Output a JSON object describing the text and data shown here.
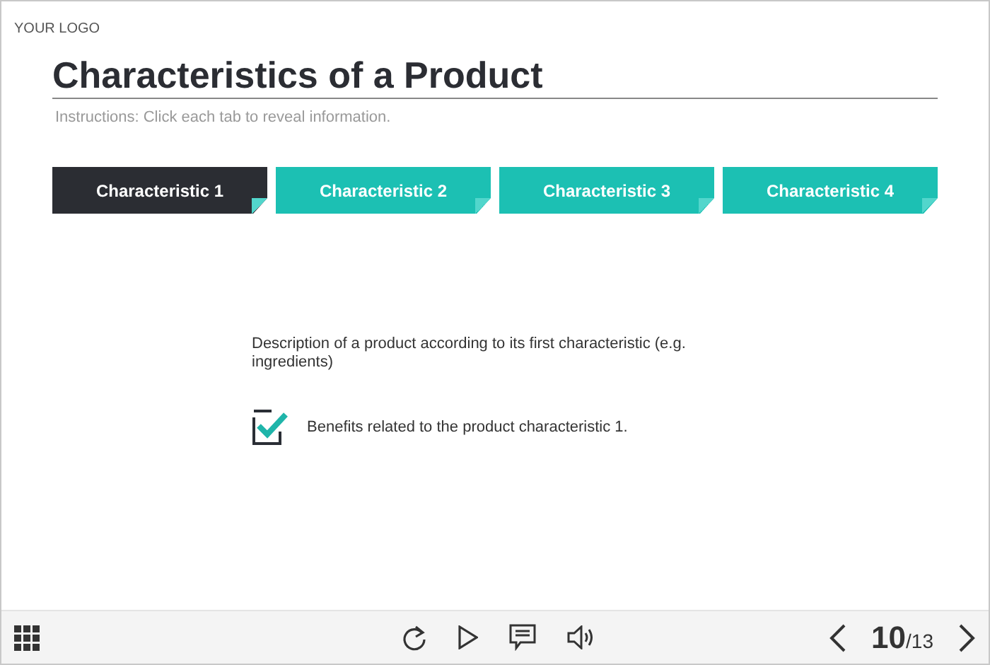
{
  "logo": "YOUR LOGO",
  "title": "Characteristics of a Product",
  "instructions": "Instructions: Click each tab to reveal information.",
  "tabs": [
    {
      "label": "Characteristic 1",
      "selected": true
    },
    {
      "label": "Characteristic 2",
      "selected": false
    },
    {
      "label": "Characteristic 3",
      "selected": false
    },
    {
      "label": "Characteristic 4",
      "selected": false
    }
  ],
  "description": "Description of a product according to its first characteristic (e.g. ingredients)",
  "benefit": {
    "label": "Benefits related to the product characteristic 1.",
    "checked": true
  },
  "pager": {
    "current": "10",
    "total": "/13"
  }
}
